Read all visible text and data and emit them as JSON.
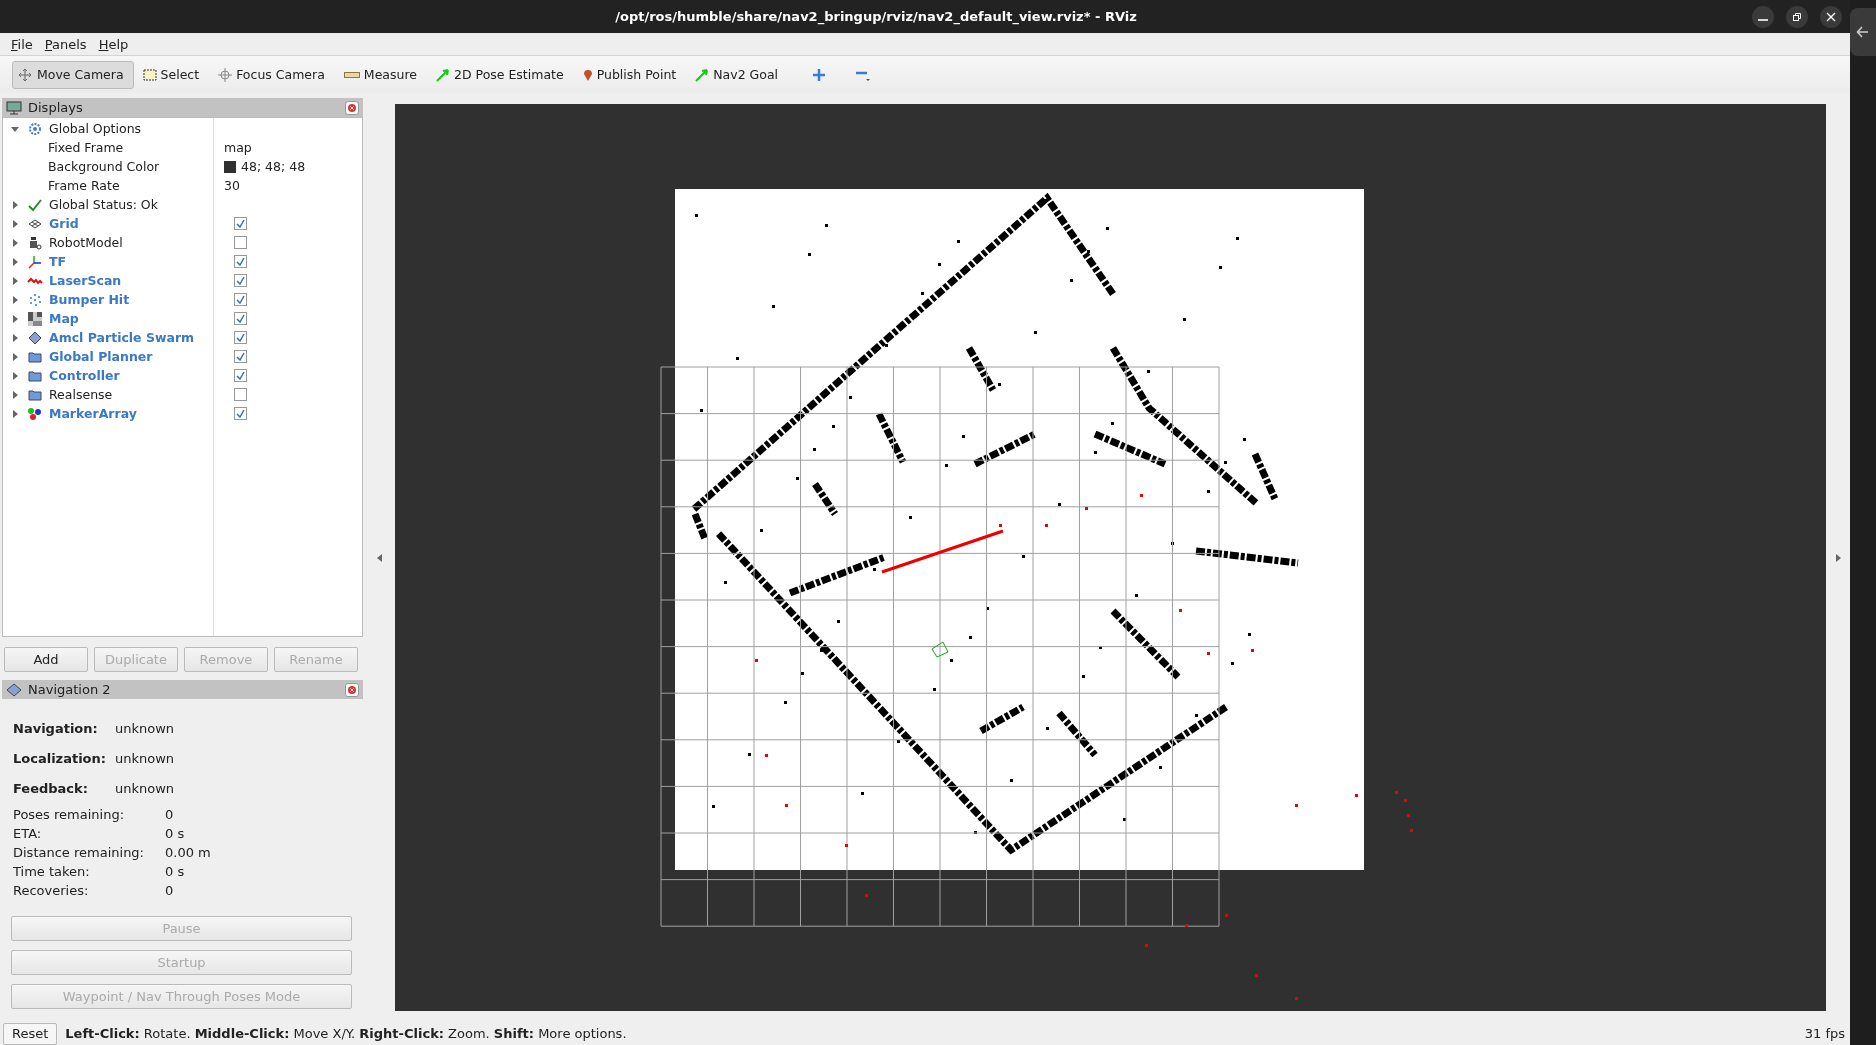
{
  "window": {
    "title": "/opt/ros/humble/share/nav2_bringup/rviz/nav2_default_view.rviz* - RViz"
  },
  "menu": [
    "File",
    "Panels",
    "Help"
  ],
  "toolbar": {
    "tools": [
      {
        "label": "Move Camera",
        "selected": true
      },
      {
        "label": "Select",
        "selected": false
      },
      {
        "label": "Focus Camera",
        "selected": false
      },
      {
        "label": "Measure",
        "selected": false
      },
      {
        "label": "2D Pose Estimate",
        "selected": false
      },
      {
        "label": "Publish Point",
        "selected": false
      },
      {
        "label": "Nav2 Goal",
        "selected": false
      }
    ]
  },
  "displays": {
    "title": "Displays",
    "tree": [
      {
        "kind": "options",
        "label": "Global Options",
        "expanded": true,
        "children": [
          {
            "label": "Fixed Frame",
            "value": "map"
          },
          {
            "label": "Background Color",
            "value": "48; 48; 48",
            "color": "#303030"
          },
          {
            "label": "Frame Rate",
            "value": "30"
          }
        ]
      },
      {
        "kind": "status",
        "label": "Global Status: Ok",
        "expanded": false
      },
      {
        "kind": "display",
        "label": "Grid",
        "expanded": false,
        "checked": true
      },
      {
        "kind": "display",
        "label": "RobotModel",
        "expanded": false,
        "checked": false
      },
      {
        "kind": "display",
        "label": "TF",
        "expanded": false,
        "checked": true
      },
      {
        "kind": "display",
        "label": "LaserScan",
        "expanded": false,
        "checked": true
      },
      {
        "kind": "display",
        "label": "Bumper Hit",
        "expanded": false,
        "checked": true
      },
      {
        "kind": "display",
        "label": "Map",
        "expanded": false,
        "checked": true
      },
      {
        "kind": "display",
        "label": "Amcl Particle Swarm",
        "expanded": false,
        "checked": true
      },
      {
        "kind": "display",
        "label": "Global Planner",
        "expanded": false,
        "checked": true
      },
      {
        "kind": "display",
        "label": "Controller",
        "expanded": false,
        "checked": true
      },
      {
        "kind": "display",
        "label": "Realsense",
        "expanded": false,
        "checked": false
      },
      {
        "kind": "display",
        "label": "MarkerArray",
        "expanded": false,
        "checked": true
      }
    ],
    "buttons": [
      {
        "label": "Add",
        "disabled": false
      },
      {
        "label": "Duplicate",
        "disabled": true
      },
      {
        "label": "Remove",
        "disabled": true
      },
      {
        "label": "Rename",
        "disabled": true
      }
    ]
  },
  "navigation": {
    "title": "Navigation 2",
    "status": [
      {
        "label": "Navigation:",
        "value": "unknown"
      },
      {
        "label": "Localization:",
        "value": "unknown"
      },
      {
        "label": "Feedback:",
        "value": "unknown"
      }
    ],
    "stats": [
      {
        "label": "Poses remaining:",
        "value": "0"
      },
      {
        "label": "ETA:",
        "value": "0 s"
      },
      {
        "label": "Distance remaining:",
        "value": "0.00 m"
      },
      {
        "label": "Time taken:",
        "value": "0 s"
      },
      {
        "label": "Recoveries:",
        "value": "0"
      }
    ],
    "buttons": [
      {
        "label": "Pause",
        "disabled": true
      },
      {
        "label": "Startup",
        "disabled": true
      },
      {
        "label": "Waypoint / Nav Through Poses Mode",
        "disabled": true
      }
    ]
  },
  "status_bar": {
    "reset": "Reset",
    "hint": "**Left-Click:** Rotate. **Middle-Click:** Move X/Y. **Right-Click:** Zoom. **Shift:** More options.",
    "fps": "31 fps"
  }
}
